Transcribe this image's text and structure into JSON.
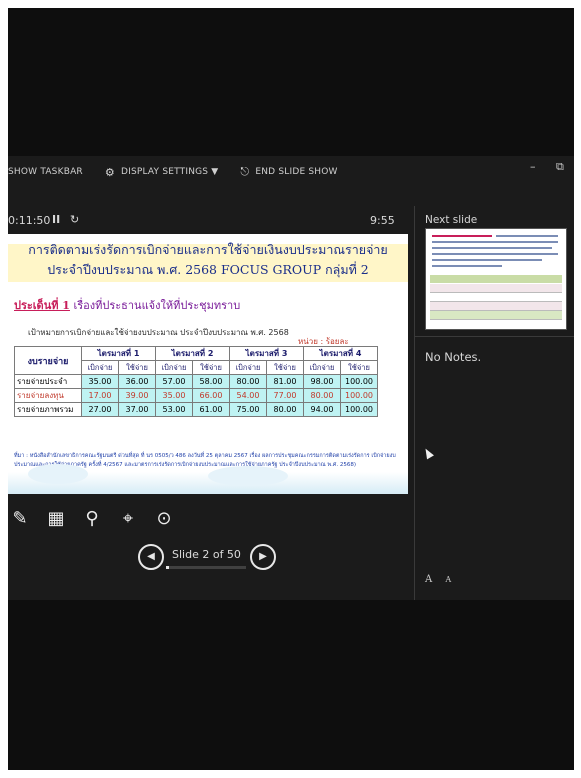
{
  "toolbar": {
    "show_taskbar": "SHOW TASKBAR",
    "display_settings": "DISPLAY SETTINGS ▼",
    "end_slide_show": "END SLIDE SHOW",
    "minimize": "–",
    "restore": "⧉"
  },
  "status": {
    "timer": "0:11:50",
    "pause": "II",
    "reset": "↻",
    "clock": "9:55"
  },
  "slide": {
    "title_line1": "การติดตามเร่งรัดการเบิกจ่ายและการใช้จ่ายเงินงบประมาณรายจ่าย",
    "title_line2": "ประจำปีงบประมาณ พ.ศ. 2568 FOCUS GROUP กลุ่มที่ 2",
    "agenda_prefix": "ประเด็นที่ 1",
    "agenda_text": " เรื่องที่ประธานแจ้งให้ที่ประชุมทราบ",
    "target": "เป้าหมายการเบิกจ่ายและใช้จ่ายงบประมาณ ประจำปีงบประมาณ พ.ศ. 2568",
    "unit": "หน่วย : ร้อยละ",
    "table": {
      "header_label": "งบรายจ่าย",
      "quarters": [
        "ไตรมาสที่ 1",
        "ไตรมาสที่ 2",
        "ไตรมาสที่ 3",
        "ไตรมาสที่ 4"
      ],
      "sub_disburse": "เบิกจ่าย",
      "sub_spend": "ใช้จ่าย",
      "rows": [
        {
          "label": "รายจ่ายประจำ",
          "values": [
            "35.00",
            "36.00",
            "57.00",
            "58.00",
            "80.00",
            "81.00",
            "98.00",
            "100.00"
          ]
        },
        {
          "label": "รายจ่ายลงทุน",
          "values": [
            "17.00",
            "39.00",
            "35.00",
            "66.00",
            "54.00",
            "77.00",
            "80.00",
            "100.00"
          ]
        },
        {
          "label": "รายจ่ายภาพรวม",
          "values": [
            "27.00",
            "37.00",
            "53.00",
            "61.00",
            "75.00",
            "80.00",
            "94.00",
            "100.00"
          ]
        }
      ]
    },
    "source": "ที่มา : หนังสือสำนักเลขาธิการคณะรัฐมนตรี ด่วนที่สุด ที่ นร 0505/ว 486 ลงวันที่ 25 ตุลาคม 2567 เรื่อง ผลการประชุมคณะกรรมการติดตามเร่งรัดการ เบิกจ่ายงบประมาณและการใช้จ่ายภาครัฐ ครั้งที่ 4/2567 และมาตรการเร่งรัดการเบิกจ่ายงบประมาณและการใช้จ่ายภาครัฐ ประจำปีงบประมาณ พ.ศ. 2568)"
  },
  "navigation": {
    "slide_label": "Slide 2 of 50",
    "progress": 0.04,
    "prev": "◀",
    "next": "▶"
  },
  "right_panel": {
    "next_slide_label": "Next slide",
    "notes": "No Notes.",
    "font_up": "A",
    "font_down": "A"
  },
  "tools": [
    "pen-icon",
    "slides-grid-icon",
    "zoom-icon",
    "laser-pointer-icon",
    "more-options-icon"
  ],
  "colors": {
    "title": "#1a2e8a",
    "agenda": "#7a1d9a",
    "cyan_cells": "#bff3f3",
    "red_row": "#c0392b"
  }
}
